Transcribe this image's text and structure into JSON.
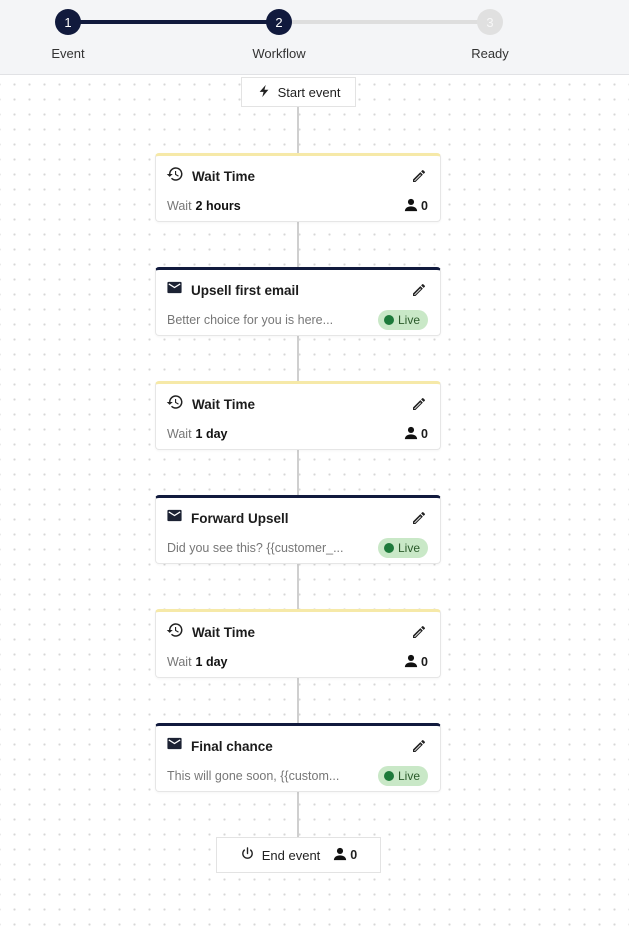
{
  "stepper": {
    "steps": [
      {
        "number": "1",
        "label": "Event",
        "state": "done"
      },
      {
        "number": "2",
        "label": "Workflow",
        "state": "active"
      },
      {
        "number": "3",
        "label": "Ready",
        "state": "pending"
      }
    ]
  },
  "workflow": {
    "start": {
      "label": "Start event",
      "icon": "lightning-icon"
    },
    "nodes": [
      {
        "type": "wait",
        "title": "Wait Time",
        "wait_word": "Wait",
        "duration": "2 hours",
        "count": "0"
      },
      {
        "type": "email",
        "title": "Upsell first email",
        "preview": "Better choice for you is here...",
        "status": "Live"
      },
      {
        "type": "wait",
        "title": "Wait Time",
        "wait_word": "Wait",
        "duration": "1 day",
        "count": "0"
      },
      {
        "type": "email",
        "title": "Forward Upsell",
        "preview": "Did you see this? {{customer_...",
        "status": "Live"
      },
      {
        "type": "wait",
        "title": "Wait Time",
        "wait_word": "Wait",
        "duration": "1 day",
        "count": "0"
      },
      {
        "type": "email",
        "title": "Final chance",
        "preview": "This will gone soon, {{custom...",
        "status": "Live"
      }
    ],
    "end": {
      "label": "End event",
      "icon": "power-icon",
      "count": "0"
    }
  },
  "colors": {
    "step_active": "#111a3d",
    "step_inactive": "#e0e0e0",
    "wait_accent": "#f6e9a8",
    "email_accent": "#111a3d",
    "live_badge_bg": "#c9e8c7",
    "live_dot": "#1d7a3a"
  }
}
